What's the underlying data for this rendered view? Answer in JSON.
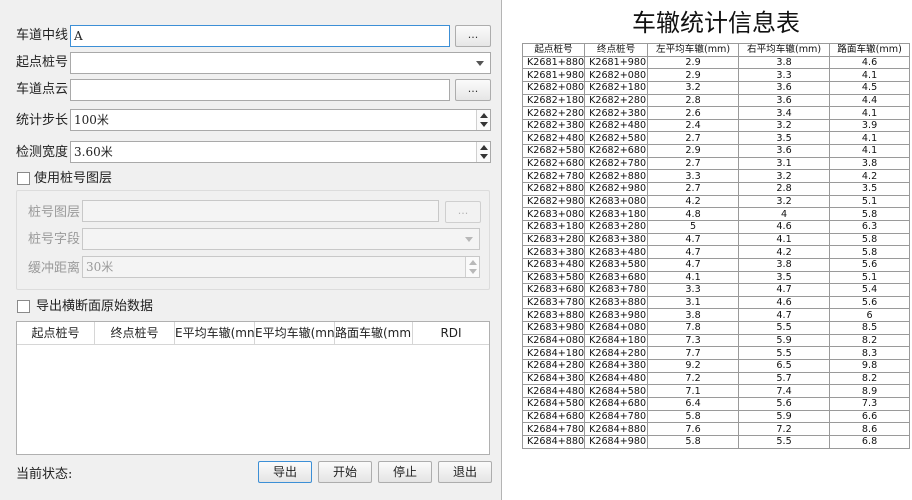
{
  "dialog": {
    "fields": {
      "lane_centerline": {
        "label": "车道中线",
        "value": "A",
        "button": "..."
      },
      "start_station": {
        "label": "起点桩号",
        "value": ""
      },
      "lane_pointcloud": {
        "label": "车道点云",
        "value": "",
        "button": "..."
      },
      "step_length": {
        "label": "统计步长",
        "value": "100米"
      },
      "detect_width": {
        "label": "检测宽度",
        "value": "3.60米"
      }
    },
    "use_station_layer": {
      "label": "使用桩号图层",
      "checked": false
    },
    "station_layer": {
      "label": "桩号图层",
      "value": "",
      "button": "..."
    },
    "station_field": {
      "label": "桩号字段",
      "value": ""
    },
    "buffer_distance": {
      "label": "缓冲距离",
      "value": "30米"
    },
    "export_raw": {
      "label": "导出横断面原始数据",
      "checked": false
    },
    "result_table": {
      "columns": [
        "起点桩号",
        "终点桩号",
        "E平均车辙(mn",
        "E平均车辙(mn",
        "路面车辙(mm)",
        "RDI"
      ]
    },
    "status_label": "当前状态:",
    "buttons": {
      "export": "导出",
      "start": "开始",
      "stop": "停止",
      "exit": "退出"
    }
  },
  "report": {
    "title": "车辙统计信息表",
    "columns": [
      "起点桩号",
      "终点桩号",
      "左平均车辙(mm)",
      "右平均车辙(mm)",
      "路面车辙(mm)"
    ],
    "rows": [
      [
        "K2681+880",
        "K2681+980",
        "2.9",
        "3.8",
        "4.6"
      ],
      [
        "K2681+980",
        "K2682+080",
        "2.9",
        "3.3",
        "4.1"
      ],
      [
        "K2682+080",
        "K2682+180",
        "3.2",
        "3.6",
        "4.5"
      ],
      [
        "K2682+180",
        "K2682+280",
        "2.8",
        "3.6",
        "4.4"
      ],
      [
        "K2682+280",
        "K2682+380",
        "2.6",
        "3.4",
        "4.1"
      ],
      [
        "K2682+380",
        "K2682+480",
        "2.4",
        "3.2",
        "3.9"
      ],
      [
        "K2682+480",
        "K2682+580",
        "2.7",
        "3.5",
        "4.1"
      ],
      [
        "K2682+580",
        "K2682+680",
        "2.9",
        "3.6",
        "4.1"
      ],
      [
        "K2682+680",
        "K2682+780",
        "2.7",
        "3.1",
        "3.8"
      ],
      [
        "K2682+780",
        "K2682+880",
        "3.3",
        "3.2",
        "4.2"
      ],
      [
        "K2682+880",
        "K2682+980",
        "2.7",
        "2.8",
        "3.5"
      ],
      [
        "K2682+980",
        "K2683+080",
        "4.2",
        "3.2",
        "5.1"
      ],
      [
        "K2683+080",
        "K2683+180",
        "4.8",
        "4",
        "5.8"
      ],
      [
        "K2683+180",
        "K2683+280",
        "5",
        "4.6",
        "6.3"
      ],
      [
        "K2683+280",
        "K2683+380",
        "4.7",
        "4.1",
        "5.8"
      ],
      [
        "K2683+380",
        "K2683+480",
        "4.7",
        "4.2",
        "5.8"
      ],
      [
        "K2683+480",
        "K2683+580",
        "4.7",
        "3.8",
        "5.6"
      ],
      [
        "K2683+580",
        "K2683+680",
        "4.1",
        "3.5",
        "5.1"
      ],
      [
        "K2683+680",
        "K2683+780",
        "3.3",
        "4.7",
        "5.4"
      ],
      [
        "K2683+780",
        "K2683+880",
        "3.1",
        "4.6",
        "5.6"
      ],
      [
        "K2683+880",
        "K2683+980",
        "3.8",
        "4.7",
        "6"
      ],
      [
        "K2683+980",
        "K2684+080",
        "7.8",
        "5.5",
        "8.5"
      ],
      [
        "K2684+080",
        "K2684+180",
        "7.3",
        "5.9",
        "8.2"
      ],
      [
        "K2684+180",
        "K2684+280",
        "7.7",
        "5.5",
        "8.3"
      ],
      [
        "K2684+280",
        "K2684+380",
        "9.2",
        "6.5",
        "9.8"
      ],
      [
        "K2684+380",
        "K2684+480",
        "7.2",
        "5.7",
        "8.2"
      ],
      [
        "K2684+480",
        "K2684+580",
        "7.1",
        "7.4",
        "8.9"
      ],
      [
        "K2684+580",
        "K2684+680",
        "6.4",
        "5.6",
        "7.3"
      ],
      [
        "K2684+680",
        "K2684+780",
        "5.8",
        "5.9",
        "6.6"
      ],
      [
        "K2684+780",
        "K2684+880",
        "7.6",
        "7.2",
        "8.6"
      ],
      [
        "K2684+880",
        "K2684+980",
        "5.8",
        "5.5",
        "6.8"
      ]
    ]
  }
}
